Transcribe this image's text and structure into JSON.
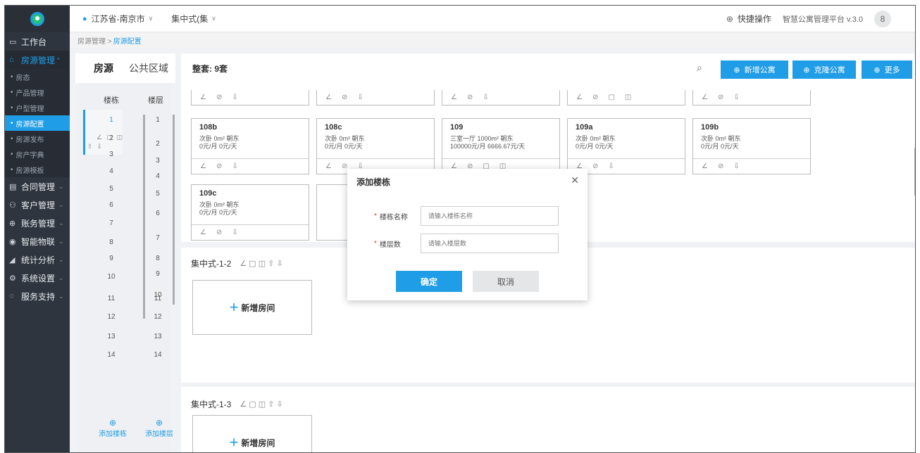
{
  "topbar": {
    "location": "江苏省-南京市",
    "mode": "集中式(集",
    "quick_ops": "快捷操作",
    "platform": "智慧公寓管理平台 v.3.0"
  },
  "breadcrumb": {
    "path": "房源管理 > ",
    "current": "房源配置"
  },
  "sidebar": {
    "workbench": "工作台",
    "house_mgmt": "房源管理",
    "sub": [
      "房态",
      "产品管理",
      "户型管理",
      "房源配置",
      "房源发布",
      "房产字典",
      "房源模板"
    ],
    "menus": [
      "合同管理",
      "客户管理",
      "账务管理",
      "智能物联",
      "统计分析",
      "系统设置",
      "服务支持"
    ]
  },
  "left_tabs": {
    "house": "房源",
    "public": "公共区域"
  },
  "building_panel": {
    "building_header": "楼栋",
    "floor_header": "楼层",
    "buildings": [
      "1",
      "2",
      "3",
      "4",
      "5",
      "6",
      "7",
      "8",
      "9",
      "10",
      "11",
      "12",
      "13",
      "14"
    ],
    "floors": [
      "1",
      "2",
      "3",
      "4",
      "5",
      "6",
      "7",
      "8",
      "9",
      "10",
      "11",
      "12",
      "13",
      "14"
    ],
    "add_building": "添加楼栋",
    "add_floor": "添加楼层"
  },
  "main": {
    "total": "整套: 9套",
    "btn_add": "新增公寓",
    "btn_clone": "克隆公寓",
    "btn_more": "更多",
    "rooms": [
      {
        "no": "108b",
        "line1": "次卧  0m²  朝东",
        "line2": "0元/月  0元/天"
      },
      {
        "no": "108c",
        "line1": "次卧  0m²  朝东",
        "line2": "0元/月  0元/天"
      },
      {
        "no": "109",
        "line1": "三室一厅  1000m²  朝东",
        "line2": "100000元/月  6666.67元/天"
      },
      {
        "no": "109a",
        "line1": "次卧  0m²  朝东",
        "line2": "0元/月  0元/天"
      },
      {
        "no": "109b",
        "line1": "次卧  0m²  朝东",
        "line2": "0元/月  0元/天"
      },
      {
        "no": "109c",
        "line1": "次卧  0m²  朝东",
        "line2": "0元/月  0元/天"
      }
    ],
    "groups": [
      "集中式-1-2",
      "集中式-1-3"
    ],
    "add_room": "新增房间"
  },
  "modal": {
    "title": "添加楼栋",
    "name_label": "楼栋名称",
    "name_placeholder": "请输入楼栋名称",
    "floors_label": "楼层数",
    "floors_placeholder": "请输入楼层数",
    "confirm": "确定",
    "cancel": "取消"
  }
}
